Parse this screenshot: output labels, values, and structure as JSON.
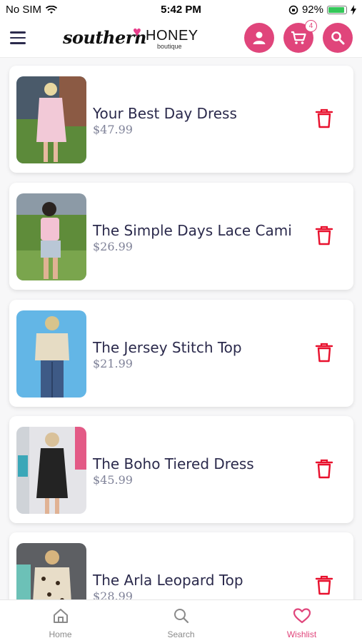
{
  "status_bar": {
    "carrier": "No SIM",
    "time": "5:42 PM",
    "battery": "92%",
    "battery_level": 0.92
  },
  "header": {
    "logo": {
      "script": "southern",
      "word": "HONEY",
      "sub": "boutique"
    },
    "cart_count": "4",
    "icons": [
      "menu-icon",
      "account-icon",
      "cart-icon",
      "search-icon"
    ],
    "accent_color": "#e0457b"
  },
  "wishlist": {
    "items": [
      {
        "name": "Your Best Day Dress",
        "price": "$47.99"
      },
      {
        "name": "The Simple Days Lace Cami",
        "price": "$26.99"
      },
      {
        "name": "The Jersey Stitch Top",
        "price": "$21.99"
      },
      {
        "name": "The Boho Tiered Dress",
        "price": "$45.99"
      },
      {
        "name": "The Arla Leopard Top",
        "price": "$28.99"
      }
    ]
  },
  "tabs": [
    {
      "label": "Home",
      "icon": "home-icon",
      "active": false
    },
    {
      "label": "Search",
      "icon": "search-icon",
      "active": false
    },
    {
      "label": "Wishlist",
      "icon": "heart-icon",
      "active": true
    }
  ]
}
